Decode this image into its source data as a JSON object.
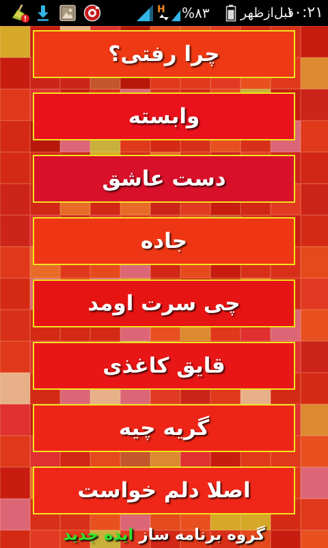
{
  "status_bar": {
    "icons": [
      "cleaner-icon",
      "download-icon",
      "gallery-icon",
      "recorder-icon",
      "signal-icon",
      "battery-icon"
    ],
    "network_type": "H",
    "battery_level": "%۸۳",
    "period": "قبل‌ازظهر",
    "time": "۱۰:۲۱"
  },
  "menu": {
    "border_color": "#f2e420",
    "items": [
      {
        "label": "چرا رفتی؟",
        "color": "#ef3814"
      },
      {
        "label": "وابسته",
        "color": "#e8111c"
      },
      {
        "label": "دست عاشق",
        "color": "#d9102a"
      },
      {
        "label": "جاده",
        "color": "#ef3614"
      },
      {
        "label": "چی سرت اومد",
        "color": "#e71414"
      },
      {
        "label": "قایق کاغذی",
        "color": "#e81616"
      },
      {
        "label": "گریه چیه",
        "color": "#ee2417"
      },
      {
        "label": "اصلا دلم خواست",
        "color": "#ef2618"
      }
    ]
  },
  "footer": {
    "prefix": "گروه برنامه ساز",
    "brand": "ایده جدید",
    "prefix_color": "#ffffff",
    "brand_color": "#2fe22f"
  }
}
